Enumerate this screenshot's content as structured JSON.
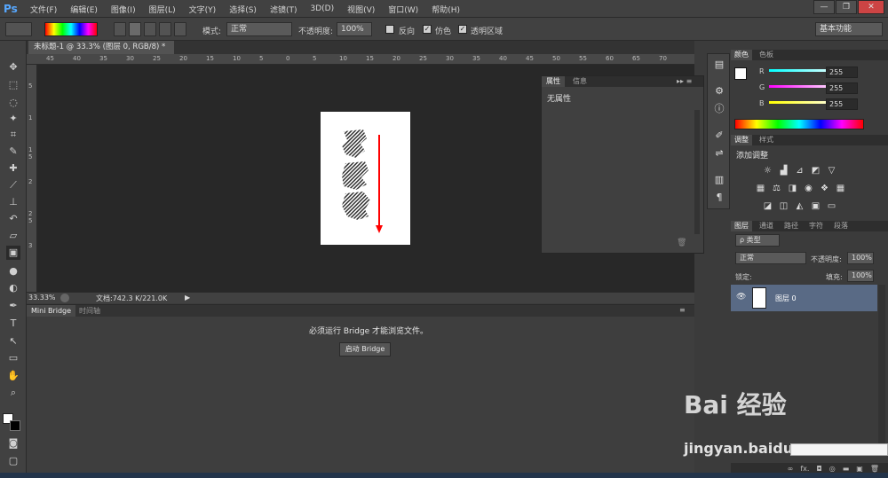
{
  "app": {
    "logo": "Ps"
  },
  "menu": [
    "文件(F)",
    "编辑(E)",
    "图像(I)",
    "图层(L)",
    "文字(Y)",
    "选择(S)",
    "滤镜(T)",
    "3D(D)",
    "视图(V)",
    "窗口(W)",
    "帮助(H)"
  ],
  "window": {
    "min": "—",
    "restore": "❐",
    "close": "✕"
  },
  "options": {
    "mode_label": "模式:",
    "mode_value": "正常",
    "opacity_label": "不透明度:",
    "opacity_value": "100%",
    "reverse_label": "反向",
    "dither_label": "仿色",
    "transparency_label": "透明区域",
    "workspace": "基本功能"
  },
  "document": {
    "tab_title": "未标题-1 @ 33.3% (图层 0, RGB/8) *",
    "close": "×"
  },
  "ruler": {
    "h": [
      "45",
      "40",
      "35",
      "30",
      "25",
      "20",
      "15",
      "10",
      "5",
      "0",
      "5",
      "10",
      "15",
      "20",
      "25",
      "30",
      "35",
      "40",
      "45",
      "50",
      "55",
      "60",
      "65",
      "70"
    ],
    "v": [
      "5",
      "1",
      "1 5",
      "2",
      "2 5",
      "3"
    ]
  },
  "status": {
    "zoom": "33.33%",
    "doc": "文档:742.3 K/221.0K",
    "arrow": "▶"
  },
  "bridge": {
    "tab1": "Mini Bridge",
    "tab2": "时间轴",
    "message": "必须运行 Bridge 才能浏览文件。",
    "button": "启动 Bridge"
  },
  "properties": {
    "tab1": "属性",
    "tab2": "信息",
    "content": "无属性",
    "trash": "🗑"
  },
  "color": {
    "tab1": "颜色",
    "tab2": "色板",
    "r_label": "R",
    "g_label": "G",
    "b_label": "B",
    "r": "255",
    "g": "255",
    "b": "255"
  },
  "adjustments": {
    "tab1": "调整",
    "tab2": "样式",
    "title": "添加调整"
  },
  "layers": {
    "tabs": [
      "图层",
      "通道",
      "路径",
      "字符",
      "段落"
    ],
    "kind": "ρ 类型",
    "blend": "正常",
    "opacity_label": "不透明度:",
    "opacity_value": "100%",
    "lock_label": "锁定:",
    "fill_label": "填充:",
    "fill_value": "100%",
    "layer_name": "图层 0",
    "bottom": [
      "∞",
      "fx.",
      "◘",
      "◎",
      "▬",
      "▣",
      "🗑"
    ]
  },
  "watermark": {
    "text": "jingyan.baidu.com",
    "brand": "Bai 经验"
  },
  "colors": {
    "accent_red": "#ff0000",
    "panel": "#3b3b3b"
  }
}
